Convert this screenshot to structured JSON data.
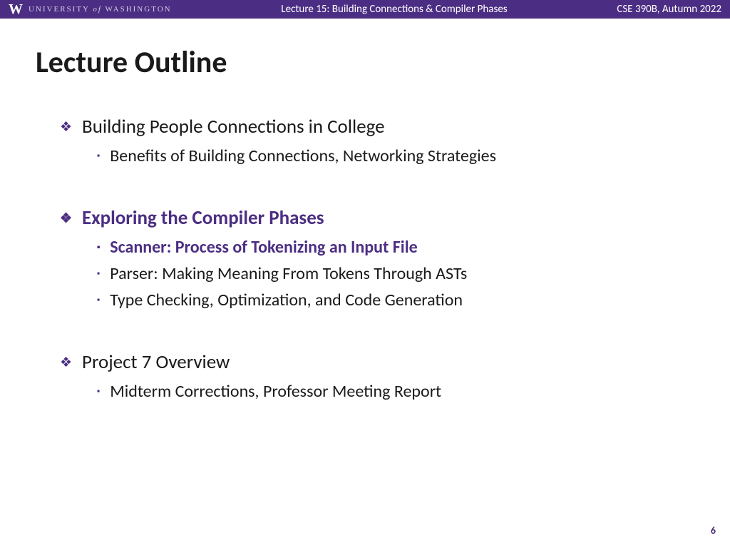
{
  "header": {
    "logo_letter": "W",
    "university_pre": "UNIVERSITY",
    "university_of": "of",
    "university_post": "WASHINGTON",
    "lecture_title": "Lecture 15: Building Connections & Compiler Phases",
    "course": "CSE 390B, Autumn 2022"
  },
  "slide": {
    "title": "Lecture Outline",
    "sections": [
      {
        "heading": "Building People Connections in College",
        "highlighted": false,
        "sub": [
          {
            "text": "Benefits of Building Connections, Networking Strategies",
            "highlighted": false
          }
        ]
      },
      {
        "heading": "Exploring the Compiler Phases",
        "highlighted": true,
        "sub": [
          {
            "text": "Scanner: Process of Tokenizing an Input File",
            "highlighted": true
          },
          {
            "text": "Parser: Making Meaning From Tokens Through ASTs",
            "highlighted": false
          },
          {
            "text": "Type Checking, Optimization, and Code Generation",
            "highlighted": false
          }
        ]
      },
      {
        "heading": "Project 7 Overview",
        "highlighted": false,
        "sub": [
          {
            "text": "Midterm Corrections, Professor Meeting Report",
            "highlighted": false
          }
        ]
      }
    ],
    "page_number": "6"
  }
}
